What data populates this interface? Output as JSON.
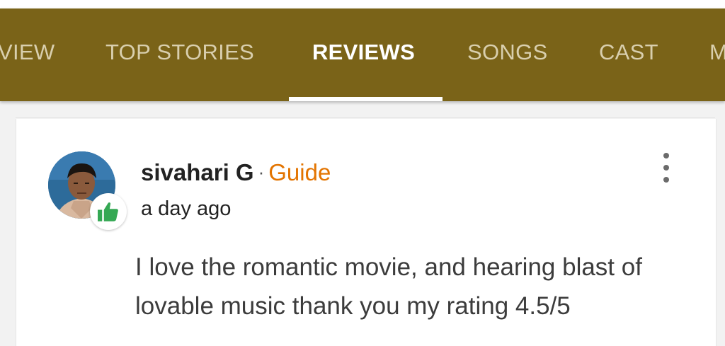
{
  "tabs": [
    {
      "label": "VIEW",
      "active": false
    },
    {
      "label": "TOP STORIES",
      "active": false
    },
    {
      "label": "REVIEWS",
      "active": true
    },
    {
      "label": "SONGS",
      "active": false
    },
    {
      "label": "CAST",
      "active": false
    },
    {
      "label": "M",
      "active": false
    }
  ],
  "colors": {
    "tab_bar": "#7a6318",
    "active_tab": "#ffffff",
    "inactive_tab": "#d9cfae",
    "guide_badge": "#e37400",
    "thumb_icon": "#34a853"
  },
  "review": {
    "author": "sivahari G",
    "separator": "·",
    "role": "Guide",
    "time": "a day ago",
    "text": "I love the romantic movie, and hearing blast of lovable music thank you my rating 4.5/5",
    "avatar_icon": "user-photo",
    "badge_icon": "thumbs-up-icon",
    "menu_icon": "more-vert-icon"
  }
}
